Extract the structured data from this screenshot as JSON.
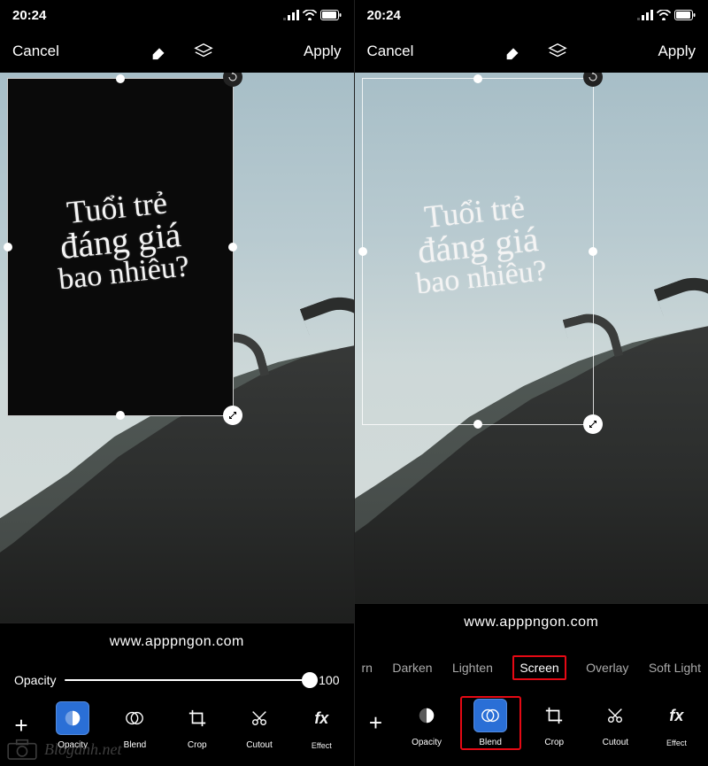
{
  "status": {
    "time": "20:24",
    "signal": "•ıll",
    "wifi": "wifi",
    "battery": "85"
  },
  "topbar": {
    "cancel": "Cancel",
    "apply": "Apply"
  },
  "overlay": {
    "line1": "Tuổi trẻ",
    "line2": "đáng giá",
    "line3": "bao nhiêu?"
  },
  "watermark": "www.apppngon.com",
  "opacity": {
    "label": "Opacity",
    "value": "100"
  },
  "blend_modes": {
    "partial_left": "rn",
    "opt1": "Darken",
    "opt2": "Lighten",
    "opt3": "Screen",
    "opt4": "Overlay",
    "opt5": "Soft Light"
  },
  "tools": {
    "opacity": "Opacity",
    "blend": "Blend",
    "crop": "Crop",
    "cutout": "Cutout",
    "effect": "Effect"
  },
  "bloganh": "Bloganh.net"
}
